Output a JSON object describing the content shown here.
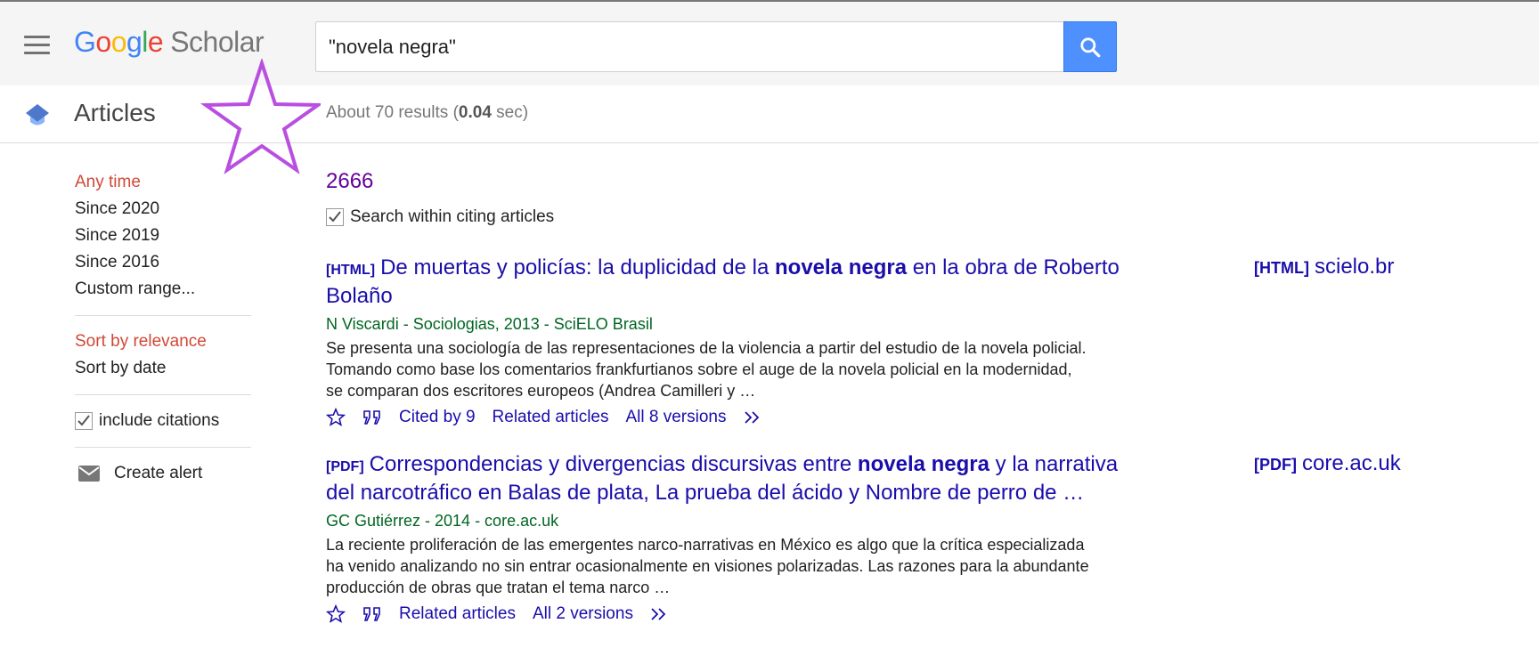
{
  "header": {
    "logo_letters": [
      "G",
      "o",
      "o",
      "g",
      "l",
      "e"
    ],
    "logo_product": "Scholar",
    "search_value": "\"novela negra\""
  },
  "subbar": {
    "section_label": "Articles",
    "stats_prefix": "About 70 results (",
    "stats_time": "0.04",
    "stats_suffix": " sec)"
  },
  "sidebar": {
    "time_filters": [
      {
        "label": "Any time",
        "selected": true
      },
      {
        "label": "Since 2020",
        "selected": false
      },
      {
        "label": "Since 2019",
        "selected": false
      },
      {
        "label": "Since 2016",
        "selected": false
      },
      {
        "label": "Custom range...",
        "selected": false
      }
    ],
    "sort_options": [
      {
        "label": "Sort by relevance",
        "selected": true
      },
      {
        "label": "Sort by date",
        "selected": false
      }
    ],
    "include_citations_label": "include citations",
    "include_citations_checked": true,
    "create_alert_label": "Create alert"
  },
  "main": {
    "citing_count": "2666",
    "search_within_label": "Search within citing articles",
    "search_within_checked": true,
    "results": [
      {
        "tag": "[HTML]",
        "title_before": "De muertas y policías: la duplicidad de la ",
        "title_bold": "novela negra",
        "title_after": " en la obra de Roberto Bolaño",
        "meta": "N Viscardi - Sociologias, 2013 - SciELO Brasil",
        "snippet": "Se presenta una sociología de las representaciones de la violencia a partir del estudio de la novela policial. Tomando como base los comentarios frankfurtianos sobre el auge de la novela policial en la modernidad, se comparan dos escritores europeos (Andrea Camilleri y …",
        "links": [
          "Cited by 9",
          "Related articles",
          "All 8 versions"
        ],
        "side_tag": "[HTML]",
        "side_domain": "scielo.br"
      },
      {
        "tag": "[PDF]",
        "title_before": "Correspondencias y divergencias discursivas entre ",
        "title_bold": "novela negra",
        "title_after": " y la narrativa del narcotráfico en Balas de plata, La prueba del ácido y Nombre de perro de …",
        "meta": "GC Gutiérrez - 2014 - core.ac.uk",
        "snippet": "La reciente proliferación de las emergentes narco-narrativas en México es algo que la crítica especializada ha venido analizando no sin entrar ocasionalmente en visiones polarizadas. Las razones para la abundante producción de obras que tratan el tema narco …",
        "links": [
          "Related articles",
          "All 2 versions"
        ],
        "side_tag": "[PDF]",
        "side_domain": "core.ac.uk"
      }
    ]
  },
  "colors": {
    "link": "#1a0dab",
    "visited": "#660099",
    "selected": "#d14836",
    "meta_green": "#006621",
    "search_button": "#4d90fe",
    "annotation_star": "#b94fe0"
  },
  "icons": [
    "menu-icon",
    "search-icon",
    "mortarboard-icon",
    "star-annotation-icon",
    "checkbox-icon",
    "envelope-icon",
    "save-star-icon",
    "cite-quote-icon",
    "more-chevrons-icon"
  ]
}
